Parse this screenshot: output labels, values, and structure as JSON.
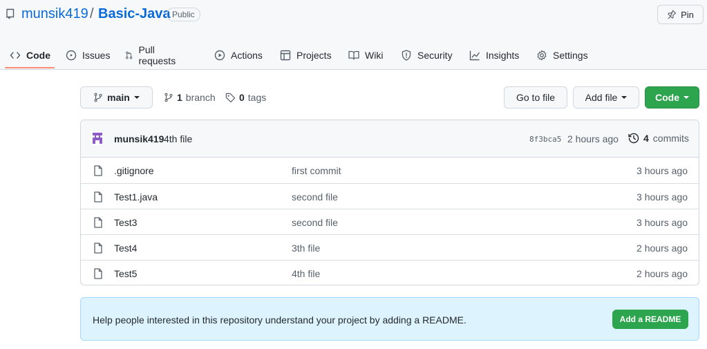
{
  "repo": {
    "owner": "munsik419",
    "separator": "/",
    "name": "Basic-Java",
    "visibility": "Public",
    "pin_label": "Pin"
  },
  "tabs": [
    {
      "label": "Code",
      "icon": "code-icon",
      "active": true
    },
    {
      "label": "Issues",
      "icon": "issue-icon"
    },
    {
      "label": "Pull requests",
      "icon": "pull-request-icon"
    },
    {
      "label": "Actions",
      "icon": "play-icon"
    },
    {
      "label": "Projects",
      "icon": "table-icon"
    },
    {
      "label": "Wiki",
      "icon": "book-icon"
    },
    {
      "label": "Security",
      "icon": "shield-icon"
    },
    {
      "label": "Insights",
      "icon": "graph-icon"
    },
    {
      "label": "Settings",
      "icon": "gear-icon"
    }
  ],
  "toolbar": {
    "branch_selector": "main",
    "branch_count": "1",
    "branch_label": "branch",
    "tag_count": "0",
    "tag_label": "tags",
    "go_to_file": "Go to file",
    "add_file": "Add file",
    "code": "Code"
  },
  "latest_commit": {
    "author": "munsik419",
    "message": "4th file",
    "sha": "8f3bca5",
    "time": "2 hours ago",
    "commit_count": "4",
    "commit_label": "commits"
  },
  "files": [
    {
      "name": ".gitignore",
      "message": "first commit",
      "time": "3 hours ago"
    },
    {
      "name": "Test1.java",
      "message": "second file",
      "time": "3 hours ago"
    },
    {
      "name": "Test3",
      "message": "second file",
      "time": "3 hours ago"
    },
    {
      "name": "Test4",
      "message": "3th file",
      "time": "2 hours ago"
    },
    {
      "name": "Test5",
      "message": "4th file",
      "time": "2 hours ago"
    }
  ],
  "readme": {
    "prompt": "Help people interested in this repository understand your project by adding a README.",
    "button": "Add a README"
  },
  "colors": {
    "link": "#0969da",
    "primary_button": "#2da44e",
    "tab_underline": "#fd8c73",
    "readme_bg": "#ddf4ff"
  }
}
